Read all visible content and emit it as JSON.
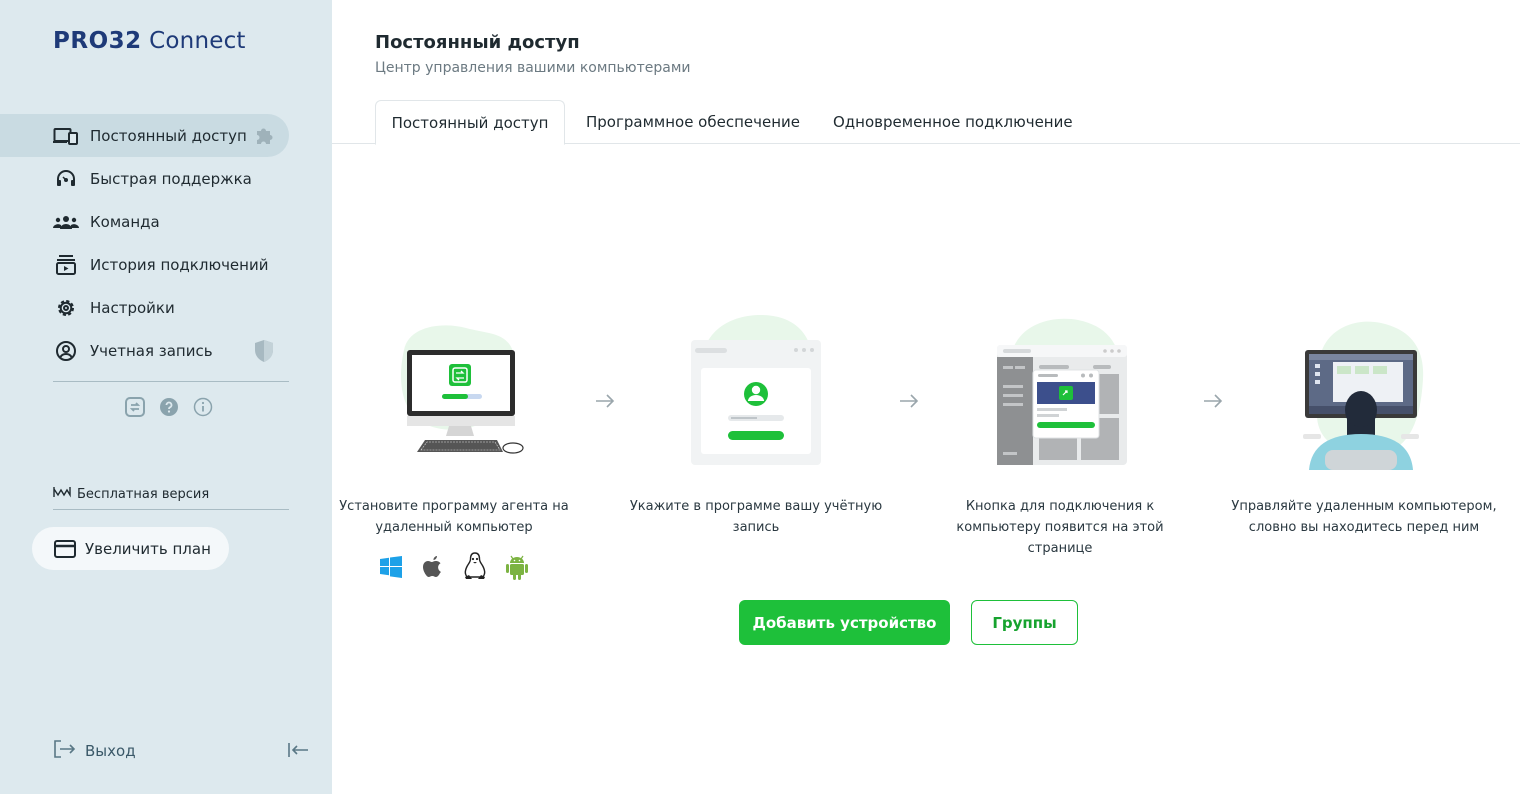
{
  "brand": {
    "part1": "PRO32",
    "part2": " Connect"
  },
  "colors": {
    "accent": "#1ec03a",
    "sidebar_bg": "#dde9ee",
    "brand_blue": "#1e3a78"
  },
  "sidebar": {
    "items": [
      {
        "label": "Постоянный доступ",
        "icon": "devices-icon",
        "trail_icon": "puzzle-icon",
        "active": true
      },
      {
        "label": "Быстрая поддержка",
        "icon": "headset-icon"
      },
      {
        "label": "Команда",
        "icon": "team-icon"
      },
      {
        "label": "История подключений",
        "icon": "history-icon"
      },
      {
        "label": "Настройки",
        "icon": "gear-icon"
      },
      {
        "label": "Учетная запись",
        "icon": "account-icon",
        "trail_icon": "shield-icon"
      }
    ],
    "mini_icons": [
      "connect-app-icon",
      "help-icon",
      "info-icon"
    ],
    "plan_label": "Бесплатная версия",
    "upgrade_label": "Увеличить план",
    "logout_label": "Выход"
  },
  "main": {
    "title": "Постоянный доступ",
    "subtitle": "Центр управления вашими компьютерами",
    "tabs": [
      {
        "label": "Постоянный доступ",
        "active": true
      },
      {
        "label": "Программное обеспечение"
      },
      {
        "label": "Одновременное подключение"
      }
    ],
    "steps": [
      {
        "caption_line1": "Установите программу агента на",
        "caption_line2": "удаленный компьютер"
      },
      {
        "caption_line1": "Укажите в программе вашу учётную",
        "caption_line2": "запись"
      },
      {
        "caption_line1": "Кнопка для подключения к",
        "caption_line2": "компьютеру появится на этой странице"
      },
      {
        "caption_line1": "Управляйте удаленным компьютером,",
        "caption_line2": "словно вы находитесь перед ним"
      }
    ],
    "os_icons": [
      "windows-icon",
      "apple-icon",
      "linux-icon",
      "android-icon"
    ],
    "add_device_label": "Добавить устройство",
    "groups_label": "Группы"
  }
}
